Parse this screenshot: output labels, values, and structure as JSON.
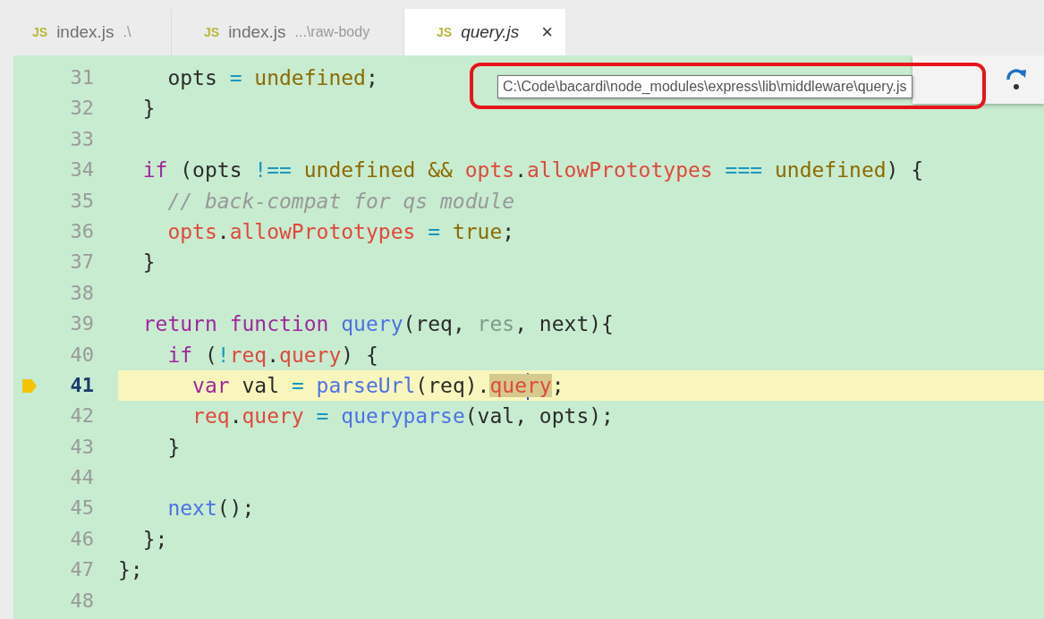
{
  "tabs": [
    {
      "icon": "JS",
      "label": "index.js",
      "detail": ".\\",
      "selected": false
    },
    {
      "icon": "JS",
      "label": "index.js",
      "detail": "...\\raw-body",
      "selected": false
    },
    {
      "icon": "JS",
      "label": "query.js",
      "close": "×",
      "selected": true
    }
  ],
  "editor": {
    "lines": [
      {
        "number": "31",
        "tokens": [
          {
            "text": "    opts ",
            "kind": "id"
          },
          {
            "text": "= ",
            "kind": "op"
          },
          {
            "text": "undefined",
            "kind": "const"
          },
          {
            "text": ";",
            "kind": "id"
          }
        ]
      },
      {
        "number": "32",
        "tokens": [
          {
            "text": "  }",
            "kind": "id"
          }
        ]
      },
      {
        "number": "33"
      },
      {
        "number": "34",
        "tokens": [
          {
            "text": "  if",
            "kind": "kw"
          },
          {
            "text": " (opts ",
            "kind": "id"
          },
          {
            "text": "!== ",
            "kind": "op"
          },
          {
            "text": "undefined ",
            "kind": "const"
          },
          {
            "text": "&& ",
            "kind": "const"
          },
          {
            "text": "opts",
            "kind": "prop"
          },
          {
            "text": ".",
            "kind": "id"
          },
          {
            "text": "allowPrototypes ",
            "kind": "prop"
          },
          {
            "text": "=== ",
            "kind": "op"
          },
          {
            "text": "undefined",
            "kind": "const"
          },
          {
            "text": ") {",
            "kind": "id"
          }
        ]
      },
      {
        "number": "35",
        "tokens": [
          {
            "text": "    // back-compat for qs module",
            "kind": "comment"
          }
        ]
      },
      {
        "number": "36",
        "tokens": [
          {
            "text": "    opts",
            "kind": "prop"
          },
          {
            "text": ".",
            "kind": "id"
          },
          {
            "text": "allowPrototypes ",
            "kind": "prop"
          },
          {
            "text": "= ",
            "kind": "op"
          },
          {
            "text": "true",
            "kind": "const"
          },
          {
            "text": ";",
            "kind": "id"
          }
        ]
      },
      {
        "number": "37",
        "tokens": [
          {
            "text": "  }",
            "kind": "id"
          }
        ]
      },
      {
        "number": "38"
      },
      {
        "number": "39",
        "tokens": [
          {
            "text": "  return ",
            "kind": "kw"
          },
          {
            "text": "function ",
            "kind": "kw"
          },
          {
            "text": "query",
            "kind": "fn"
          },
          {
            "text": "(req, ",
            "kind": "id"
          },
          {
            "text": "res",
            "kind": "unused"
          },
          {
            "text": ", next){",
            "kind": "id"
          }
        ]
      },
      {
        "number": "40",
        "tokens": [
          {
            "text": "    if",
            "kind": "kw"
          },
          {
            "text": " (",
            "kind": "id"
          },
          {
            "text": "!",
            "kind": "op"
          },
          {
            "text": "req",
            "kind": "prop"
          },
          {
            "text": ".",
            "kind": "id"
          },
          {
            "text": "query",
            "kind": "prop"
          },
          {
            "text": ") {",
            "kind": "id"
          }
        ]
      },
      {
        "number": "41",
        "current": true,
        "breakpoint": true,
        "tokens": [
          {
            "text": "      var",
            "kind": "kw"
          },
          {
            "text": " val ",
            "kind": "id"
          },
          {
            "text": "= ",
            "kind": "op"
          },
          {
            "text": "parseUrl",
            "kind": "fn"
          },
          {
            "text": "(req).",
            "kind": "id"
          },
          {
            "text": "que",
            "kind": "prop",
            "highlighted": true,
            "cursor_after": true
          },
          {
            "text": "ry",
            "kind": "prop",
            "highlighted": true
          },
          {
            "text": ";",
            "kind": "id"
          }
        ]
      },
      {
        "number": "42",
        "tokens": [
          {
            "text": "      req",
            "kind": "prop"
          },
          {
            "text": ".",
            "kind": "id"
          },
          {
            "text": "query ",
            "kind": "prop"
          },
          {
            "text": "= ",
            "kind": "op"
          },
          {
            "text": "queryparse",
            "kind": "fn"
          },
          {
            "text": "(val, opts);",
            "kind": "id"
          }
        ]
      },
      {
        "number": "43",
        "tokens": [
          {
            "text": "    }",
            "kind": "id"
          }
        ]
      },
      {
        "number": "44"
      },
      {
        "number": "45",
        "tokens": [
          {
            "text": "    next",
            "kind": "fn"
          },
          {
            "text": "();",
            "kind": "id"
          }
        ]
      },
      {
        "number": "46",
        "tokens": [
          {
            "text": "  };",
            "kind": "id"
          }
        ]
      },
      {
        "number": "47",
        "tokens": [
          {
            "text": "};",
            "kind": "id"
          }
        ]
      },
      {
        "number": "48"
      }
    ]
  },
  "tooltip": {
    "text": "C:\\Code\\bacardi\\node_modules\\express\\lib\\middleware\\query.js",
    "circled": true
  }
}
